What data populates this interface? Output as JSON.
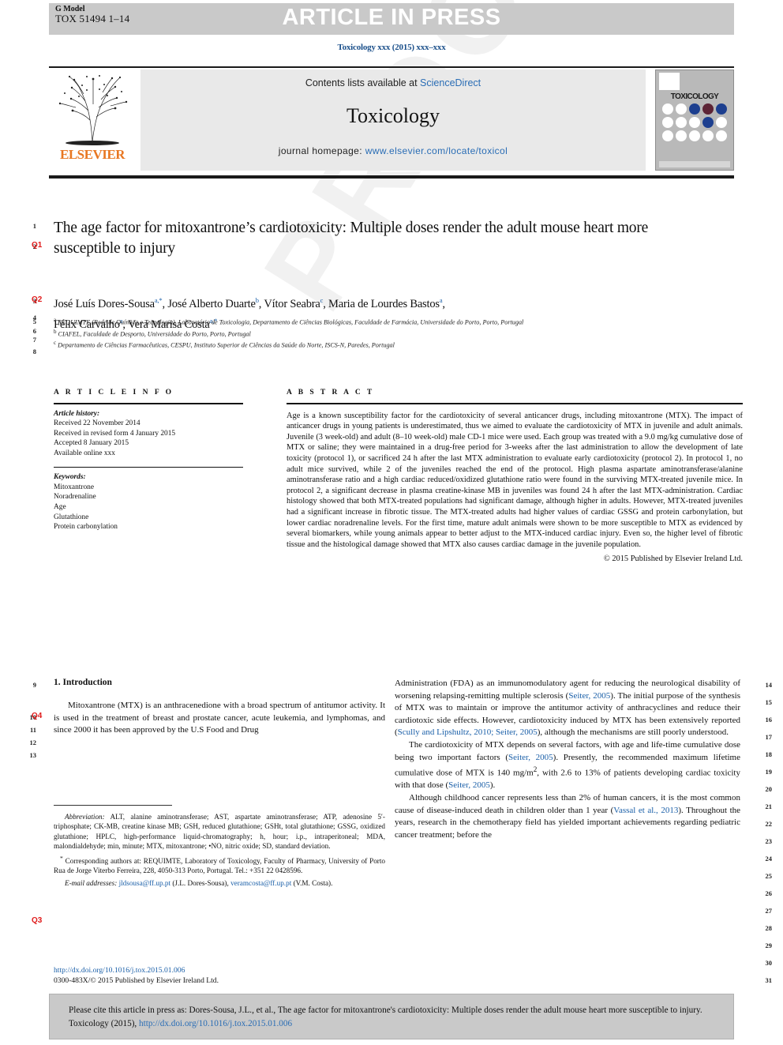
{
  "header": {
    "g_model_label": "G Model",
    "g_model_id": "TOX 51494 1–14",
    "article_in_press": "ARTICLE IN PRESS",
    "journal_citation": "Toxicology xxx (2015) xxx–xxx"
  },
  "masthead": {
    "contents_prefix": "Contents lists available at ",
    "contents_link": "ScienceDirect",
    "journal_title": "Toxicology",
    "homepage_prefix": "journal homepage: ",
    "homepage_url": "www.elsevier.com/locate/toxicol",
    "publisher_logo_text": "ELSEVIER",
    "cover_title": "TOXICOLOGY"
  },
  "article": {
    "title": "The age factor for mitoxantrone’s cardiotoxicity: Multiple doses render the adult mouse heart more susceptible to injury",
    "authors_line1": "José Luís Dores-Sousa",
    "authors_line1b": ", José Alberto Duarte",
    "authors_line1c": ", Vítor Seabra",
    "authors_line1d": ", Maria de Lourdes Bastos",
    "authors_line2": "Félix Carvalho",
    "authors_line2b": ", Vera Marisa Costa",
    "affiliation_a": "REQUIMTE (Rede de Química e Tecnologia), Laboratório de Toxicologia, Departamento de Ciências Biológicas, Faculdade de Farmácia, Universidade do Porto, Porto, Portugal",
    "affiliation_b": "CIAFEL, Faculdade de Desporto, Universidade do Porto, Porto, Portugal",
    "affiliation_c": "Departamento de Ciências Farmacêuticas, CESPU, Instituto Superior de Ciências da Saúde do Norte, ISCS-N, Paredes, Portugal"
  },
  "info": {
    "heading": "A R T I C L E   I N F O",
    "history_label": "Article history:",
    "history": [
      "Received 22 November 2014",
      "Received in revised form 4 January 2015",
      "Accepted 8 January 2015",
      "Available online xxx"
    ],
    "keywords_label": "Keywords:",
    "keywords": [
      "Mitoxantrone",
      "Noradrenaline",
      "Age",
      "Glutathione",
      "Protein carbonylation"
    ]
  },
  "abstract": {
    "heading": "A B S T R A C T",
    "text": "Age is a known susceptibility factor for the cardiotoxicity of several anticancer drugs, including mitoxantrone (MTX). The impact of anticancer drugs in young patients is underestimated, thus we aimed to evaluate the cardiotoxicity of MTX in juvenile and adult animals. Juvenile (3 week-old) and adult (8–10 week-old) male CD-1 mice were used. Each group was treated with a 9.0 mg/kg cumulative dose of MTX or saline; they were maintained in a drug-free period for 3-weeks after the last administration to allow the development of late toxicity (protocol 1), or sacrificed 24 h after the last MTX administration to evaluate early cardiotoxicity (protocol 2). In protocol 1, no adult mice survived, while 2 of the juveniles reached the end of the protocol. High plasma aspartate aminotransferase/alanine aminotransferase ratio and a high cardiac reduced/oxidized glutathione ratio were found in the surviving MTX-treated juvenile mice. In protocol 2, a significant decrease in plasma creatine-kinase MB in juveniles was found 24 h after the last MTX-administration. Cardiac histology showed that both MTX-treated populations had significant damage, although higher in adults. However, MTX-treated juveniles had a significant increase in fibrotic tissue. The MTX-treated adults had higher values of cardiac GSSG and protein carbonylation, but lower cardiac noradrenaline levels. For the first time, mature adult animals were shown to be more susceptible to MTX as evidenced by several biomarkers, while young animals appear to better adjust to the MTX-induced cardiac injury. Even so, the higher level of fibrotic tissue and the histological damage showed that MTX also causes cardiac damage in the juvenile population.",
    "copyright": "© 2015 Published by Elsevier Ireland Ltd."
  },
  "body": {
    "section_heading": "1. Introduction",
    "left_para1": "Mitoxantrone (MTX) is an anthracenedione with a broad spectrum of antitumor activity. It is used in the treatment of breast and prostate cancer, acute leukemia, and lymphomas, and since 2000 it has been approved by the U.S Food and Drug",
    "right_para1": "Administration (FDA) as an immunomodulatory agent for reducing the neurological disability of worsening relapsing-remitting multiple sclerosis (Seiter, 2005). The initial purpose of the synthesis of MTX was to maintain or improve the antitumor activity of anthracyclines and reduce their cardiotoxic side effects. However, cardiotoxicity induced by MTX has been extensively reported (Scully and Lipshultz, 2010; Seiter, 2005), although the mechanisms are still poorly understood.",
    "right_para2": "The cardiotoxicity of MTX depends on several factors, with age and life-time cumulative dose being two important factors (Seiter, 2005). Presently, the recommended maximum lifetime cumulative dose of MTX is 140 mg/m², with 2.6 to 13% of patients developing cardiac toxicity with that dose (Seiter, 2005).",
    "right_para3": "Although childhood cancer represents less than 2% of human cancers, it is the most common cause of disease-induced death in children older than 1 year (Vassal et al., 2013). Throughout the years, research in the chemotherapy field has yielded important achievements regarding pediatric cancer treatment; before the"
  },
  "footnote": {
    "abbrev_label": "Abbreviation:",
    "abbrev_text": "ALT, alanine aminotransferase; AST, aspartate aminotransferase; ATP, adenosine 5′-triphosphate; CK-MB, creatine kinase MB; GSH, reduced glutathione; GSHt, total glutathione; GSSG, oxidized glutathione; HPLC, high-performance liquid-chromatography; h, hour; i.p., intraperitoneal; MDA, malondialdehyde; min, minute; MTX, mitoxantrone; •NO, nitric oxide; SD, standard deviation.",
    "corresponding": "Corresponding authors at: REQUIMTE, Laboratory of Toxicology, Faculty of Pharmacy, University of Porto Rua de Jorge Viterbo Ferreira, 228, 4050-313 Porto, Portugal. Tel.: +351 22 0428596.",
    "email_label": "E-mail addresses:",
    "email1": "jldsousa@ff.up.pt",
    "email1_owner": " (J.L. Dores-Sousa), ",
    "email2": "veramcosta@ff.up.pt",
    "email2_owner": "(V.M. Costa).",
    "doi_url": "http://dx.doi.org/10.1016/j.tox.2015.01.006",
    "issn_line": "0300-483X/© 2015 Published by Elsevier Ireland Ltd."
  },
  "citation_footer": {
    "text_part1": "Please cite this article in press as: Dores-Sousa, J.L., et al., The age factor for mitoxantrone's cardiotoxicity: Multiple doses render the adult mouse heart more susceptible to injury. Toxicology (2015), ",
    "doi": "http://dx.doi.org/10.1016/j.tox.2015.01.006"
  },
  "margins": {
    "left_numbers_top": [
      "1",
      "2",
      "3",
      "4",
      "5",
      "6",
      "7",
      "8"
    ],
    "left_numbers_body": [
      "9",
      "10",
      "11",
      "12",
      "13"
    ],
    "right_numbers": [
      "14",
      "15",
      "16",
      "17",
      "18",
      "19",
      "20",
      "21",
      "22",
      "23",
      "24",
      "25",
      "26",
      "27",
      "28",
      "29",
      "30",
      "31"
    ],
    "queries": [
      "Q1",
      "Q2",
      "Q3",
      "Q4"
    ]
  },
  "watermark": "PROOF",
  "colors": {
    "link": "#1a5fa8",
    "query_red": "#e01b1b",
    "elsevier_orange": "#E87722",
    "band_grey": "#c9c9c9"
  }
}
